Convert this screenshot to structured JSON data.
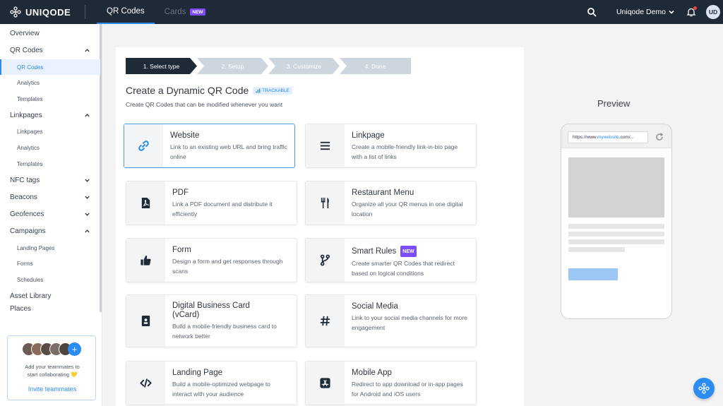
{
  "topbar": {
    "brand": "UNIQODE",
    "tabs": [
      {
        "label": "QR Codes",
        "active": true
      },
      {
        "label": "Cards",
        "active": false,
        "badge": "NEW"
      }
    ],
    "account_name": "Uniqode Demo",
    "avatar_initials": "UD"
  },
  "sidebar": {
    "items": [
      {
        "label": "Overview"
      },
      {
        "label": "QR Codes",
        "expanded": true
      },
      {
        "label": "QR Codes",
        "sub": true,
        "selected": true
      },
      {
        "label": "Analytics",
        "sub": true
      },
      {
        "label": "Templates",
        "sub": true
      },
      {
        "label": "Linkpages",
        "expanded": true
      },
      {
        "label": "Linkpages",
        "sub": true
      },
      {
        "label": "Analytics",
        "sub": true
      },
      {
        "label": "Templates",
        "sub": true
      },
      {
        "label": "NFC tags",
        "expanded": false
      },
      {
        "label": "Beacons",
        "expanded": false
      },
      {
        "label": "Geofences",
        "expanded": false
      },
      {
        "label": "Campaigns",
        "expanded": true
      },
      {
        "label": "Landing Pages",
        "sub": true
      },
      {
        "label": "Forms",
        "sub": true
      },
      {
        "label": "Schedules",
        "sub": true
      },
      {
        "label": "Asset Library"
      },
      {
        "label": "Places"
      }
    ],
    "invite": {
      "text": "Add your teammates to start collaborating 💛",
      "link": "Invite teammates"
    }
  },
  "wizard": {
    "steps": [
      "1. Select type",
      "2. Setup",
      "3. Customize",
      "4. Done"
    ],
    "active_step": 0,
    "title": "Create a Dynamic QR Code",
    "badge": "TRACKABLE",
    "subtitle": "Create QR Codes that can be modified whenever you want"
  },
  "qr_types": [
    {
      "name": "Website",
      "desc": "Link to an existing web URL and bring traffic online",
      "icon": "link-icon",
      "selected": true
    },
    {
      "name": "Linkpage",
      "desc": "Create a mobile-friendly link-in-bio page with a list of links",
      "icon": "menu-lines-icon"
    },
    {
      "name": "PDF",
      "desc": "Link a PDF document and distribute it efficiently",
      "icon": "pdf-icon"
    },
    {
      "name": "Restaurant Menu",
      "desc": "Organize all your QR menus in one digital location",
      "icon": "fork-knife-icon"
    },
    {
      "name": "Form",
      "desc": "Design a form and get responses through scans",
      "icon": "thumbs-up-icon"
    },
    {
      "name": "Smart Rules",
      "desc": "Create smarter QR Codes that redirect based on logical conditions",
      "icon": "branch-icon",
      "badge": "NEW"
    },
    {
      "name": "Digital Business Card (vCard)",
      "desc": "Build a mobile-friendly business card to network better",
      "icon": "id-card-icon"
    },
    {
      "name": "Social Media",
      "desc": "Link to your social media channels for more engagement",
      "icon": "hashtag-icon"
    },
    {
      "name": "Landing Page",
      "desc": "Build a mobile-optimized webpage to interact with your audience",
      "icon": "code-icon"
    },
    {
      "name": "Mobile App",
      "desc": "Redirect to app download or in-app pages for Android and iOS users",
      "icon": "app-store-icon"
    }
  ],
  "preview": {
    "title": "Preview",
    "url_prefix": "https://www.",
    "url_highlight": "mywebsite",
    "url_suffix": ".com/..."
  },
  "colors": {
    "accent": "#2d8cf0",
    "topbar": "#1f2a37",
    "step_active": "#1f2a37",
    "step_inactive": "#cdd5df",
    "new_badge": "#7c4dff"
  }
}
